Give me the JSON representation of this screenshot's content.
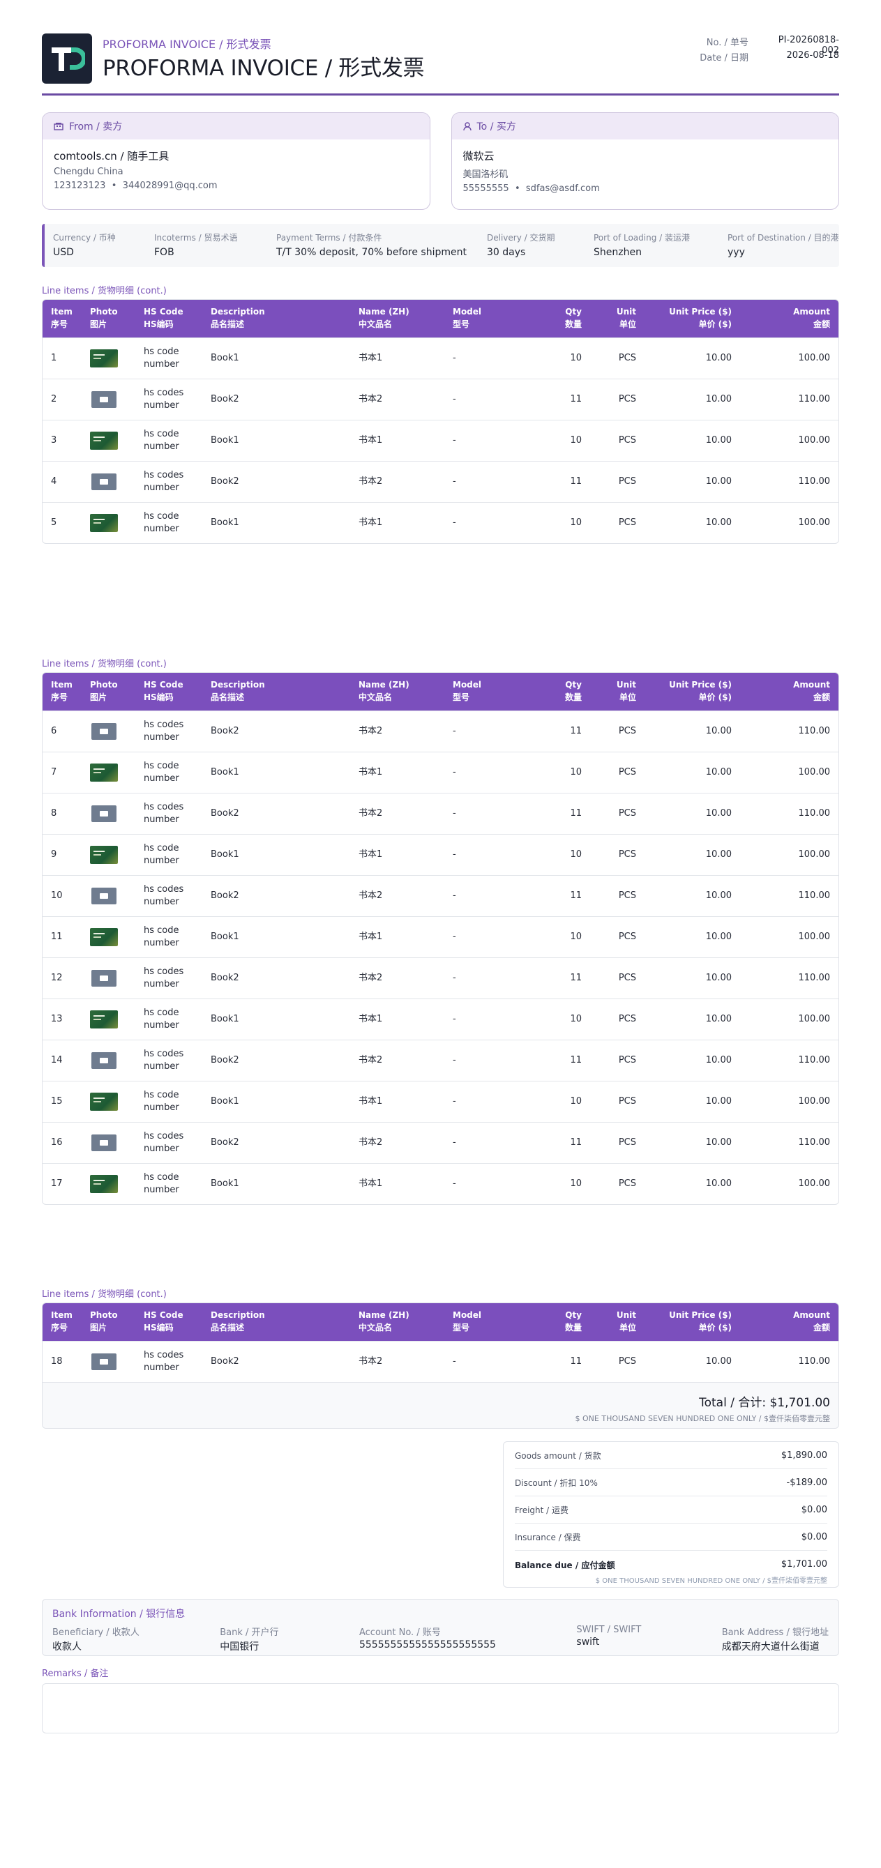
{
  "document": {
    "title_small": "PROFORMA INVOICE / 形式发票",
    "title_big": "PROFORMA INVOICE / 形式发票",
    "number_label": "No. / 单号",
    "number_value": "PI-20260818-002",
    "date_label": "Date / 日期",
    "date_value": "2026-08-18",
    "brand_color": "#7b4fbd"
  },
  "from": {
    "heading": "From / 卖方",
    "name": "comtools.cn / 随手工具",
    "address": "Chengdu China",
    "phone": "123123123",
    "email": "344028991@qq.com"
  },
  "to": {
    "heading": "To / 买方",
    "name": "微软云",
    "address": "美国洛杉矶",
    "phone": "55555555",
    "email": "sdfas@asdf.com"
  },
  "terms": [
    {
      "label": "Currency / 币种",
      "value": "USD"
    },
    {
      "label": "Incoterms / 贸易术语",
      "value": "FOB"
    },
    {
      "label": "Payment Terms / 付款条件",
      "value": "T/T 30% deposit, 70% before shipment"
    },
    {
      "label": "Delivery / 交货期",
      "value": "30 days"
    },
    {
      "label": "Port of Loading / 装运港",
      "value": "Shenzhen"
    },
    {
      "label": "Port of Destination / 目的港",
      "value": "yyy"
    }
  ],
  "items_section_label": "Line items / 货物明细 (cont.)",
  "columns": {
    "item_en": "Item",
    "item_zh": "序号",
    "photo_en": "Photo",
    "photo_zh": "图片",
    "hs_en": "HS Code",
    "hs_zh": "HS编码",
    "desc_en": "Description",
    "desc_zh": "品名描述",
    "namezh_en": "Name (ZH)",
    "namezh_zh": "中文品名",
    "model_en": "Model",
    "model_zh": "型号",
    "qty_en": "Qty",
    "qty_zh": "数量",
    "unit_en": "Unit",
    "unit_zh": "单位",
    "price_en": "Unit Price ($)",
    "price_zh": "单价 ($)",
    "amount_en": "Amount",
    "amount_zh": "金额"
  },
  "pages": [
    {
      "rows": [
        {
          "item": "1",
          "photo": "green-book-thumbnail",
          "hs1": "hs code",
          "hs2": "number",
          "desc": "Book1",
          "name_zh": "书本1",
          "model": "-",
          "qty": "10",
          "unit": "PCS",
          "price": "10.00",
          "amount": "100.00"
        },
        {
          "item": "2",
          "photo": "grey-image-thumbnail",
          "hs1": "hs codes",
          "hs2": "number",
          "desc": "Book2",
          "name_zh": "书本2",
          "model": "-",
          "qty": "11",
          "unit": "PCS",
          "price": "10.00",
          "amount": "110.00"
        },
        {
          "item": "3",
          "photo": "green-book-thumbnail",
          "hs1": "hs code",
          "hs2": "number",
          "desc": "Book1",
          "name_zh": "书本1",
          "model": "-",
          "qty": "10",
          "unit": "PCS",
          "price": "10.00",
          "amount": "100.00"
        },
        {
          "item": "4",
          "photo": "grey-image-thumbnail",
          "hs1": "hs codes",
          "hs2": "number",
          "desc": "Book2",
          "name_zh": "书本2",
          "model": "-",
          "qty": "11",
          "unit": "PCS",
          "price": "10.00",
          "amount": "110.00"
        },
        {
          "item": "5",
          "photo": "green-book-thumbnail",
          "hs1": "hs code",
          "hs2": "number",
          "desc": "Book1",
          "name_zh": "书本1",
          "model": "-",
          "qty": "10",
          "unit": "PCS",
          "price": "10.00",
          "amount": "100.00"
        }
      ]
    },
    {
      "rows": [
        {
          "item": "6",
          "photo": "grey-image-thumbnail",
          "hs1": "hs codes",
          "hs2": "number",
          "desc": "Book2",
          "name_zh": "书本2",
          "model": "-",
          "qty": "11",
          "unit": "PCS",
          "price": "10.00",
          "amount": "110.00"
        },
        {
          "item": "7",
          "photo": "green-book-thumbnail",
          "hs1": "hs code",
          "hs2": "number",
          "desc": "Book1",
          "name_zh": "书本1",
          "model": "-",
          "qty": "10",
          "unit": "PCS",
          "price": "10.00",
          "amount": "100.00"
        },
        {
          "item": "8",
          "photo": "grey-image-thumbnail",
          "hs1": "hs codes",
          "hs2": "number",
          "desc": "Book2",
          "name_zh": "书本2",
          "model": "-",
          "qty": "11",
          "unit": "PCS",
          "price": "10.00",
          "amount": "110.00"
        },
        {
          "item": "9",
          "photo": "green-book-thumbnail",
          "hs1": "hs code",
          "hs2": "number",
          "desc": "Book1",
          "name_zh": "书本1",
          "model": "-",
          "qty": "10",
          "unit": "PCS",
          "price": "10.00",
          "amount": "100.00"
        },
        {
          "item": "10",
          "photo": "grey-image-thumbnail",
          "hs1": "hs codes",
          "hs2": "number",
          "desc": "Book2",
          "name_zh": "书本2",
          "model": "-",
          "qty": "11",
          "unit": "PCS",
          "price": "10.00",
          "amount": "110.00"
        },
        {
          "item": "11",
          "photo": "green-book-thumbnail",
          "hs1": "hs code",
          "hs2": "number",
          "desc": "Book1",
          "name_zh": "书本1",
          "model": "-",
          "qty": "10",
          "unit": "PCS",
          "price": "10.00",
          "amount": "100.00"
        },
        {
          "item": "12",
          "photo": "grey-image-thumbnail",
          "hs1": "hs codes",
          "hs2": "number",
          "desc": "Book2",
          "name_zh": "书本2",
          "model": "-",
          "qty": "11",
          "unit": "PCS",
          "price": "10.00",
          "amount": "110.00"
        },
        {
          "item": "13",
          "photo": "green-book-thumbnail",
          "hs1": "hs code",
          "hs2": "number",
          "desc": "Book1",
          "name_zh": "书本1",
          "model": "-",
          "qty": "10",
          "unit": "PCS",
          "price": "10.00",
          "amount": "100.00"
        },
        {
          "item": "14",
          "photo": "grey-image-thumbnail",
          "hs1": "hs codes",
          "hs2": "number",
          "desc": "Book2",
          "name_zh": "书本2",
          "model": "-",
          "qty": "11",
          "unit": "PCS",
          "price": "10.00",
          "amount": "110.00"
        },
        {
          "item": "15",
          "photo": "green-book-thumbnail",
          "hs1": "hs code",
          "hs2": "number",
          "desc": "Book1",
          "name_zh": "书本1",
          "model": "-",
          "qty": "10",
          "unit": "PCS",
          "price": "10.00",
          "amount": "100.00"
        },
        {
          "item": "16",
          "photo": "grey-image-thumbnail",
          "hs1": "hs codes",
          "hs2": "number",
          "desc": "Book2",
          "name_zh": "书本2",
          "model": "-",
          "qty": "11",
          "unit": "PCS",
          "price": "10.00",
          "amount": "110.00"
        },
        {
          "item": "17",
          "photo": "green-book-thumbnail",
          "hs1": "hs code",
          "hs2": "number",
          "desc": "Book1",
          "name_zh": "书本1",
          "model": "-",
          "qty": "10",
          "unit": "PCS",
          "price": "10.00",
          "amount": "100.00"
        }
      ]
    },
    {
      "rows": [
        {
          "item": "18",
          "photo": "grey-image-thumbnail",
          "hs1": "hs codes",
          "hs2": "number",
          "desc": "Book2",
          "name_zh": "书本2",
          "model": "-",
          "qty": "11",
          "unit": "PCS",
          "price": "10.00",
          "amount": "110.00"
        }
      ]
    }
  ],
  "total": {
    "label": "Total / 合计: $1,701.00",
    "words": "$ ONE THOUSAND SEVEN HUNDRED ONE ONLY / $壹仟柒佰零壹元整"
  },
  "summary": [
    {
      "label": "Goods amount / 货款",
      "value": "$1,890.00"
    },
    {
      "label": "Discount / 折扣 10%",
      "value": "-$189.00"
    },
    {
      "label": "Freight / 运费",
      "value": "$0.00"
    },
    {
      "label": "Insurance / 保费",
      "value": "$0.00"
    }
  ],
  "balance": {
    "label": "Balance due / 应付金额",
    "value": "$1,701.00",
    "words": "$ ONE THOUSAND SEVEN HUNDRED ONE ONLY / $壹仟柒佰零壹元整"
  },
  "bank": {
    "title": "Bank Information / 银行信息",
    "fields": [
      {
        "label": "Beneficiary / 收款人",
        "value": "收款人"
      },
      {
        "label": "Bank / 开户行",
        "value": "中国银行"
      },
      {
        "label": "Account No. / 账号",
        "value": "5555555555555555555555"
      },
      {
        "label": "SWIFT / SWIFT",
        "value": "swift"
      },
      {
        "label": "Bank Address / 银行地址",
        "value": "成都天府大道什么街道"
      }
    ]
  },
  "remarks_label": "Remarks / 备注"
}
